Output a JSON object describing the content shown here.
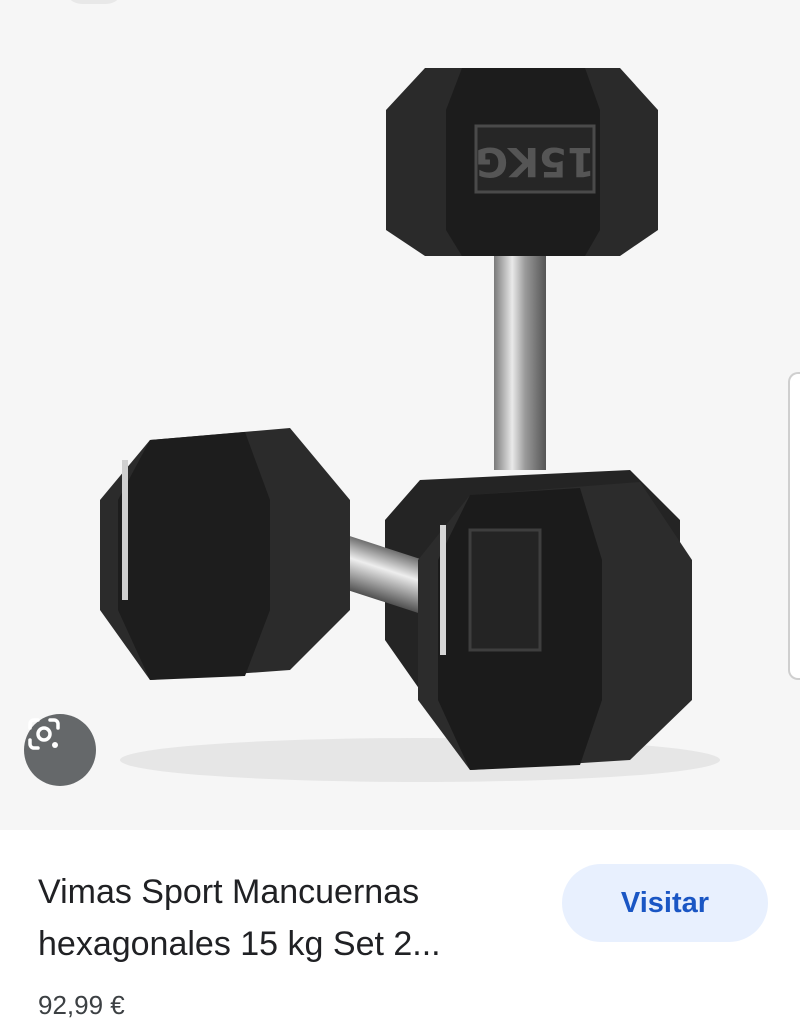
{
  "product": {
    "title_line1": "Vimas Sport Mancuernas",
    "title_line2": "hexagonales 15 kg Set 2...",
    "price": "92,99 €"
  },
  "actions": {
    "visit_label": "Visitar",
    "lens_icon": "google-lens-icon"
  },
  "image": {
    "weight_label": "15KG",
    "subject": "dumbbells"
  },
  "colors": {
    "visit_bg": "#e8f0fe",
    "visit_text": "#1a56c4",
    "lens_bg": "#3c4043"
  }
}
